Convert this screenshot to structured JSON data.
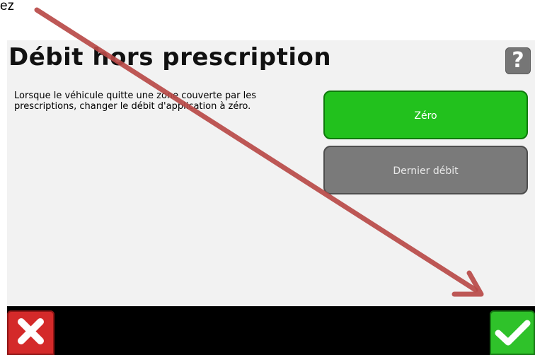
{
  "doc_fragment": "ez",
  "dialog": {
    "title": "Débit hors prescription",
    "help_label": "?",
    "description": "Lorsque le véhicule quitte une zone couverte par les prescriptions, changer le débit d'application à zéro.",
    "options": [
      {
        "label": "Zéro",
        "selected": true
      },
      {
        "label": "Dernier débit",
        "selected": false
      }
    ]
  },
  "colors": {
    "selected_option": "#22c11d",
    "unselected_option": "#7a7a7a",
    "cancel": "#d42a2a",
    "confirm": "#2fc22a",
    "annotation_arrow": "#b94a48"
  },
  "icons": {
    "cancel": "close-icon",
    "confirm": "checkmark-icon",
    "help": "question-mark-icon"
  }
}
